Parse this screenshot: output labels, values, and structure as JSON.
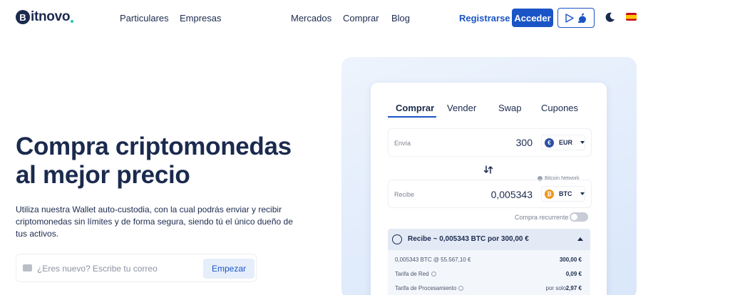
{
  "brand": {
    "logo_mark": "B",
    "logo_text": "itnovo"
  },
  "nav": {
    "left": [
      "Particulares",
      "Empresas"
    ],
    "center": [
      "Mercados",
      "Comprar",
      "Blog"
    ],
    "register": "Registrarse",
    "login": "Acceder"
  },
  "hero": {
    "title": "Compra criptomonedas al mejor precio",
    "subtitle": "Utiliza nuestra Wallet auto-custodia, con la cual podrás enviar y recibir criptomonedas sin límites y de forma segura, siendo tú el único dueño de tus activos.",
    "email_placeholder": "¿Eres nuevo? Escribe tu correo",
    "start_button": "Empezar"
  },
  "widget": {
    "tabs": [
      "Comprar",
      "Vender",
      "Swap",
      "Cupones"
    ],
    "send": {
      "label": "Envía",
      "amount": "300",
      "currency": "EUR"
    },
    "receive": {
      "label": "Recibe",
      "amount": "0,005343",
      "currency": "BTC",
      "network": "Bitcoin Network"
    },
    "recurring_label": "Compra recurrente",
    "summary": {
      "title": "Recibe ~ 0,005343 BTC por 300,00 €",
      "rows": [
        {
          "label": "0,005343 BTC @ 55.567,10 €",
          "value": "300,00 €"
        },
        {
          "label": "Tarifa de Red",
          "value": "0,09 €"
        },
        {
          "label": "Tarifa de Procesamiento",
          "note": "por solo",
          "value": "2,97 €"
        }
      ]
    }
  },
  "colors": {
    "primary": "#1a55c7",
    "text": "#1b2a4e",
    "accent": "#1ec9a7"
  }
}
